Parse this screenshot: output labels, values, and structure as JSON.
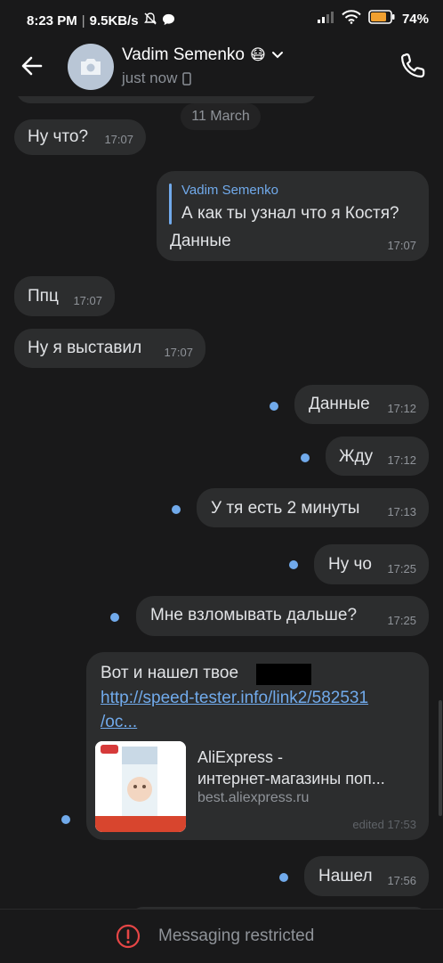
{
  "status_bar": {
    "time": "8:23 PM",
    "speed": "9.5KB/s",
    "battery": "74"
  },
  "header": {
    "contact_name": "Vadim Semenko",
    "emoji": "😷",
    "presence": "just now"
  },
  "chat": {
    "date_label": "11 March",
    "messages": [
      {
        "text": "Ну что?",
        "time": "17:07"
      },
      {
        "reply_author": "Vadim Semenko",
        "reply_text": "А как ты узнал что я Костя?",
        "text": "Данные",
        "time": "17:07"
      },
      {
        "text": "Ппц",
        "time": "17:07"
      },
      {
        "text": "Ну я выставил",
        "time": "17:07"
      },
      {
        "text": "Данные",
        "time": "17:12"
      },
      {
        "text": "Жду",
        "time": "17:12"
      },
      {
        "text": "У тя есть 2 минуты",
        "time": "17:13"
      },
      {
        "text": "Ну чо",
        "time": "17:25"
      },
      {
        "text": "Мне взломывать дальше?",
        "time": "17:25"
      },
      {
        "text": "Вот и нашел твое",
        "link_line1": "http://speed-tester.info/link2/582531",
        "link_line2": "/oc...",
        "preview_title": "AliExpress -",
        "preview_subtitle": "интернет-магазины поп...",
        "preview_domain": "best.aliexpress.ru",
        "time": "edited 17:53"
      },
      {
        "text": "Нашел",
        "time": "17:56"
      }
    ]
  },
  "footer": {
    "restricted_label": "Messaging restricted"
  },
  "colors": {
    "accent": "#71aaeb",
    "background": "#19191a",
    "bubble": "#2c2d2e",
    "alert": "#e64646"
  }
}
